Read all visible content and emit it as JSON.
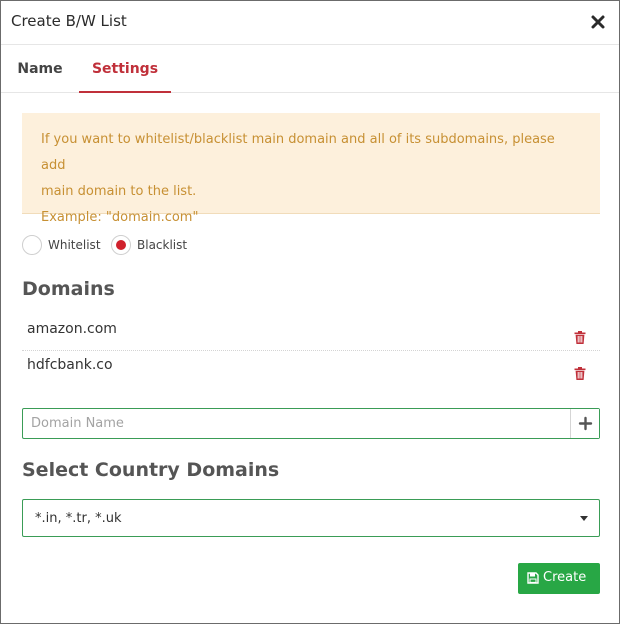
{
  "modal": {
    "title": "Create B/W List"
  },
  "tabs": [
    {
      "label": "Name",
      "active": false
    },
    {
      "label": "Settings",
      "active": true
    }
  ],
  "alert": {
    "line1": "If you want to whitelist/blacklist main domain and all of its subdomains, please add",
    "line2": "main domain to the list.",
    "line3": "Example: \"domain.com\""
  },
  "list_type": {
    "options": [
      {
        "label": "Whitelist",
        "checked": false
      },
      {
        "label": "Blacklist",
        "checked": true
      }
    ]
  },
  "domains": {
    "title": "Domains",
    "items": [
      "amazon.com",
      "hdfcbank.co"
    ],
    "input_placeholder": "Domain Name",
    "input_value": ""
  },
  "country_domains": {
    "title": "Select Country Domains",
    "selected": "*.in, *.tr, *.uk"
  },
  "actions": {
    "create_label": "Create"
  },
  "colors": {
    "accent": "#c0303a",
    "radio_checked": "#d0212c",
    "alert_bg": "#fdf0dc",
    "alert_text": "#c79033",
    "success": "#28a745",
    "input_border": "#3a9c56",
    "trash": "#c0303a"
  },
  "icons": {
    "close": "close-icon",
    "trash": "trash-icon",
    "add": "plus-icon",
    "dropdown": "chevron-down-icon",
    "save": "save-icon"
  }
}
